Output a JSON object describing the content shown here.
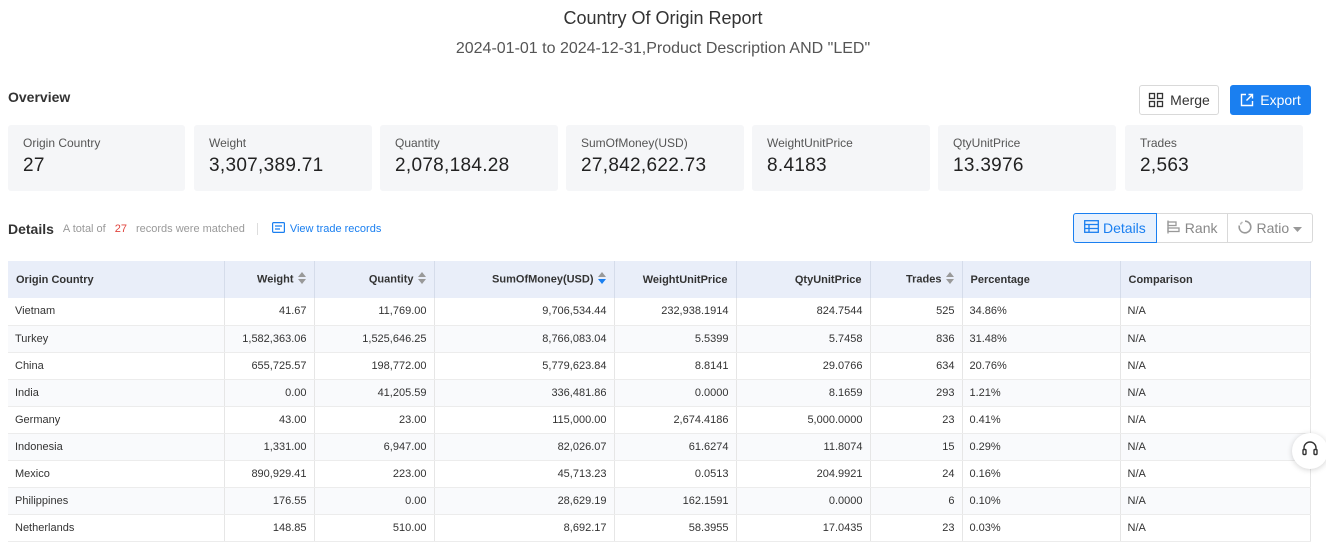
{
  "report": {
    "title": "Country Of Origin Report",
    "subtitle": "2024-01-01 to 2024-12-31,Product Description AND \"LED\""
  },
  "overview": {
    "label": "Overview",
    "merge_label": "Merge",
    "export_label": "Export",
    "cards": [
      {
        "label": "Origin Country",
        "value": "27"
      },
      {
        "label": "Weight",
        "value": "3,307,389.71"
      },
      {
        "label": "Quantity",
        "value": "2,078,184.28"
      },
      {
        "label": "SumOfMoney(USD)",
        "value": "27,842,622.73"
      },
      {
        "label": "WeightUnitPrice",
        "value": "8.4183"
      },
      {
        "label": "QtyUnitPrice",
        "value": "13.3976"
      },
      {
        "label": "Trades",
        "value": "2,563"
      }
    ]
  },
  "details": {
    "title": "Details",
    "note_prefix": "A total of",
    "count": "27",
    "note_suffix": "records were matched",
    "view_link": "View trade records",
    "tabs": [
      {
        "label": "Details",
        "icon": "table-icon",
        "active": true
      },
      {
        "label": "Rank",
        "icon": "bar-rank-icon",
        "active": false
      },
      {
        "label": "Ratio",
        "icon": "ratio-icon",
        "active": false
      }
    ]
  },
  "table": {
    "columns": [
      "Origin Country",
      "Weight",
      "Quantity",
      "SumOfMoney(USD)",
      "WeightUnitPrice",
      "QtyUnitPrice",
      "Trades",
      "Percentage",
      "Comparison"
    ],
    "rows": [
      [
        "Vietnam",
        "41.67",
        "11,769.00",
        "9,706,534.44",
        "232,938.1914",
        "824.7544",
        "525",
        "34.86%",
        "N/A"
      ],
      [
        "Turkey",
        "1,582,363.06",
        "1,525,646.25",
        "8,766,083.04",
        "5.5399",
        "5.7458",
        "836",
        "31.48%",
        "N/A"
      ],
      [
        "China",
        "655,725.57",
        "198,772.00",
        "5,779,623.84",
        "8.8141",
        "29.0766",
        "634",
        "20.76%",
        "N/A"
      ],
      [
        "India",
        "0.00",
        "41,205.59",
        "336,481.86",
        "0.0000",
        "8.1659",
        "293",
        "1.21%",
        "N/A"
      ],
      [
        "Germany",
        "43.00",
        "23.00",
        "115,000.00",
        "2,674.4186",
        "5,000.0000",
        "23",
        "0.41%",
        "N/A"
      ],
      [
        "Indonesia",
        "1,331.00",
        "6,947.00",
        "82,026.07",
        "61.6274",
        "11.8074",
        "15",
        "0.29%",
        "N/A"
      ],
      [
        "Mexico",
        "890,929.41",
        "223.00",
        "45,713.23",
        "0.0513",
        "204.9921",
        "24",
        "0.16%",
        "N/A"
      ],
      [
        "Philippines",
        "176.55",
        "0.00",
        "28,629.19",
        "162.1591",
        "0.0000",
        "6",
        "0.10%",
        "N/A"
      ],
      [
        "Netherlands",
        "148.85",
        "510.00",
        "8,692.17",
        "58.3955",
        "17.0435",
        "23",
        "0.03%",
        "N/A"
      ]
    ]
  },
  "colors": {
    "accent": "#1a7ff0",
    "count": "#e0443e",
    "header_bg": "#e9eef9",
    "card_bg": "#f5f6f8"
  }
}
